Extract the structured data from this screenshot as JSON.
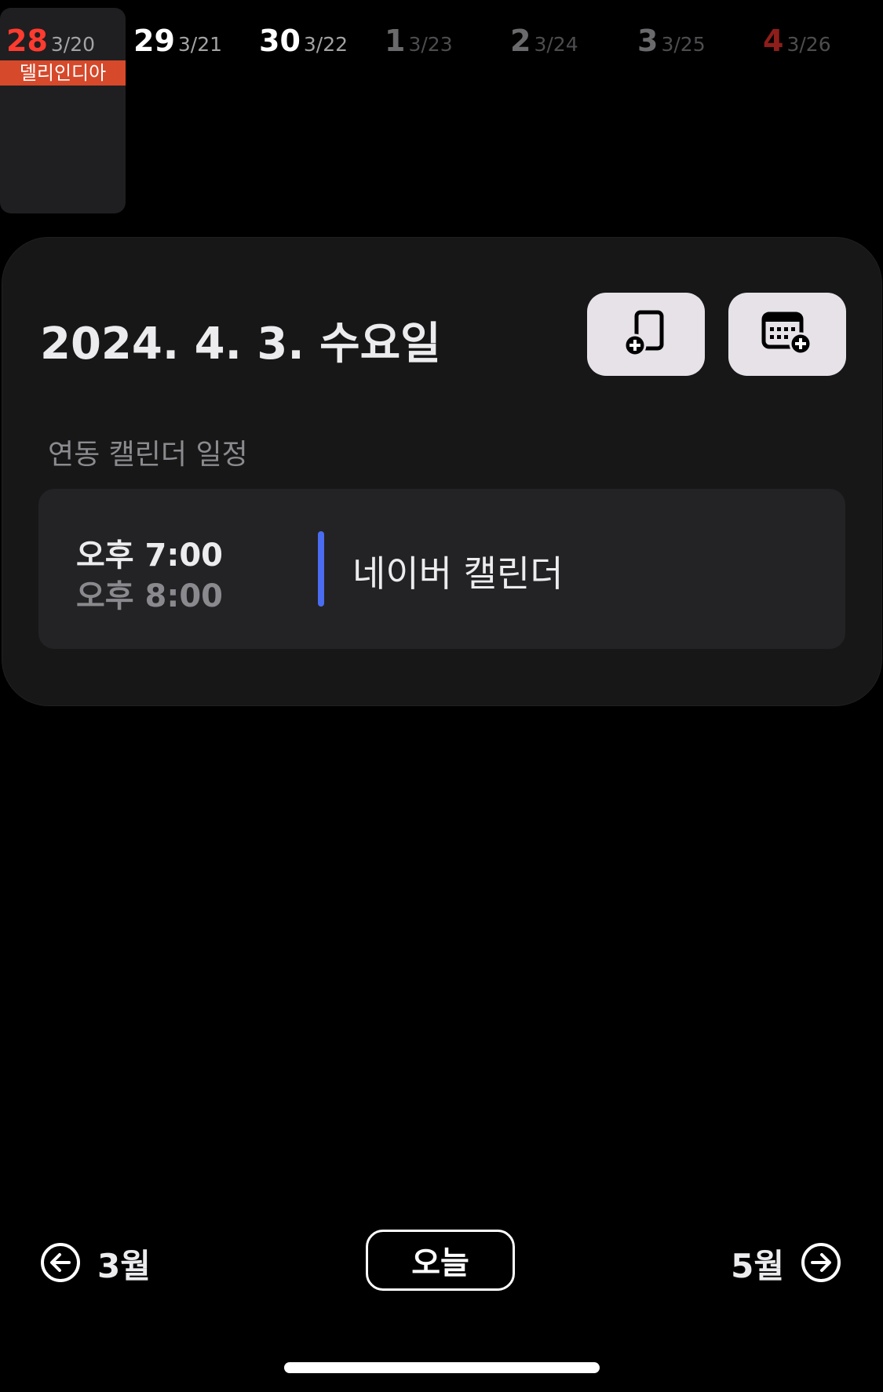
{
  "week": {
    "days": [
      {
        "day": "28",
        "lunar": "3/20",
        "event": "델리인디아"
      },
      {
        "day": "29",
        "lunar": "3/21"
      },
      {
        "day": "30",
        "lunar": "3/22"
      },
      {
        "day": "1",
        "lunar": "3/23"
      },
      {
        "day": "2",
        "lunar": "3/24"
      },
      {
        "day": "3",
        "lunar": "3/25"
      },
      {
        "day": "4",
        "lunar": "3/26"
      }
    ]
  },
  "card": {
    "date_title": "2024. 4. 3. 수요일",
    "add_note_icon": "add-document-icon",
    "add_event_icon": "add-calendar-icon",
    "section_label": "연동 캘린더 일정",
    "event": {
      "start": "오후 7:00",
      "end": "오후 8:00",
      "title": "네이버 캘린더",
      "color": "#4a6cf0"
    }
  },
  "nav": {
    "prev_label": "3월",
    "today_label": "오늘",
    "next_label": "5월"
  }
}
